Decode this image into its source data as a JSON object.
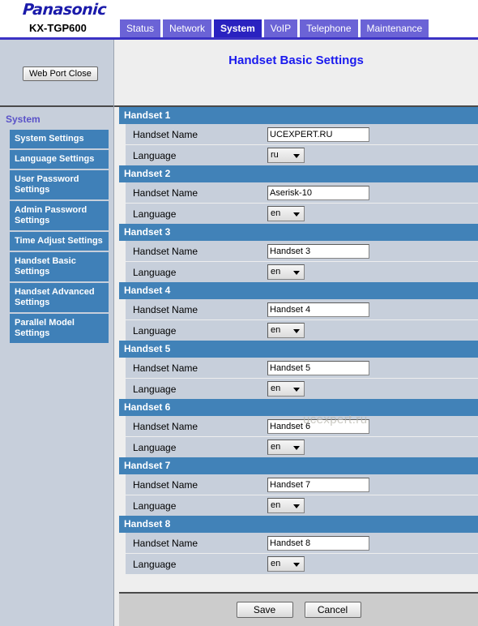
{
  "brand": {
    "logo_text": "Panasonic",
    "model": "KX-TGP600"
  },
  "tabs": [
    {
      "label": "Status",
      "active": false
    },
    {
      "label": "Network",
      "active": false
    },
    {
      "label": "System",
      "active": true
    },
    {
      "label": "VoIP",
      "active": false
    },
    {
      "label": "Telephone",
      "active": false
    },
    {
      "label": "Maintenance",
      "active": false
    }
  ],
  "sidebar": {
    "web_port_close_label": "Web Port Close",
    "section_title": "System",
    "items": [
      {
        "label": "System Settings"
      },
      {
        "label": "Language Settings"
      },
      {
        "label": "User Password Settings"
      },
      {
        "label": "Admin Password Settings"
      },
      {
        "label": "Time Adjust Settings"
      },
      {
        "label": "Handset Basic Settings"
      },
      {
        "label": "Handset Advanced Settings"
      },
      {
        "label": "Parallel Model Settings"
      }
    ]
  },
  "main": {
    "page_title": "Handset Basic Settings",
    "labels": {
      "handset_name": "Handset Name",
      "language": "Language"
    },
    "handsets": [
      {
        "section": "Handset 1",
        "name": "UCEXPERT.RU",
        "language": "ru"
      },
      {
        "section": "Handset 2",
        "name": "Aserisk-10",
        "language": "en"
      },
      {
        "section": "Handset 3",
        "name": "Handset 3",
        "language": "en"
      },
      {
        "section": "Handset 4",
        "name": "Handset 4",
        "language": "en"
      },
      {
        "section": "Handset 5",
        "name": "Handset 5",
        "language": "en"
      },
      {
        "section": "Handset 6",
        "name": "Handset 6",
        "language": "en"
      },
      {
        "section": "Handset 7",
        "name": "Handset 7",
        "language": "en"
      },
      {
        "section": "Handset 8",
        "name": "Handset 8",
        "language": "en"
      }
    ]
  },
  "footer": {
    "save_label": "Save",
    "cancel_label": "Cancel"
  },
  "watermark": {
    "text": "ucexpert.ru"
  },
  "colors": {
    "tab_inactive": "#6b63d6",
    "tab_active": "#2a22c0",
    "section_header": "#4182b8",
    "sidebar_bg": "#c7cfdb",
    "row_bg": "#c7cfdb",
    "title_blue": "#1a1aee",
    "brand_blue": "#1a1aaa"
  }
}
